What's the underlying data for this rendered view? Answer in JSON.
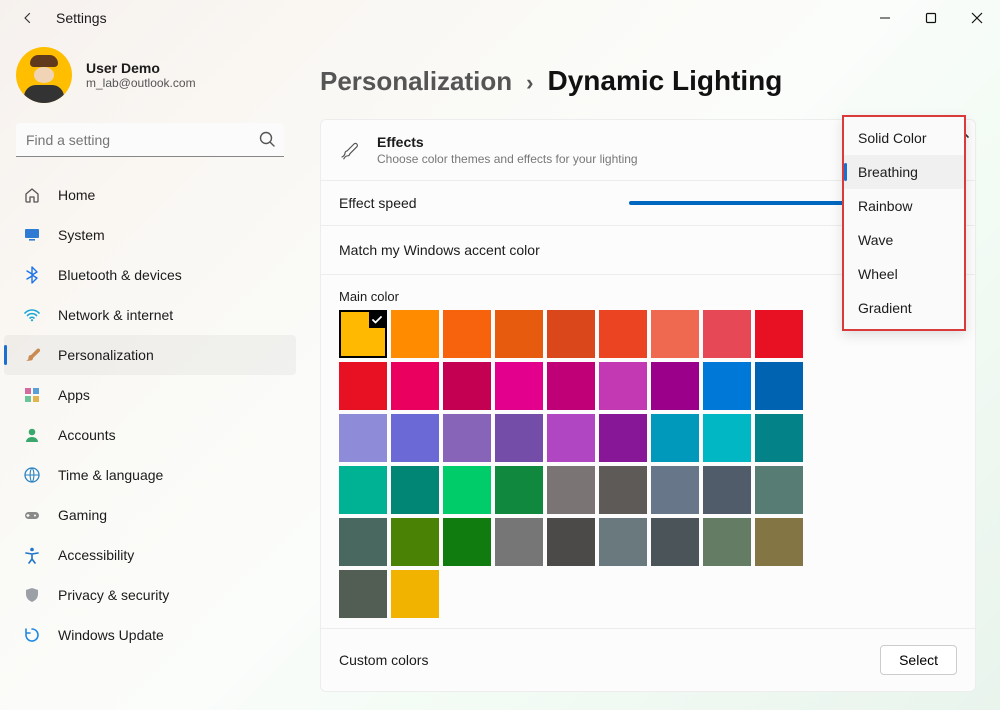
{
  "window": {
    "title": "Settings"
  },
  "profile": {
    "name": "User Demo",
    "email": "m_lab@outlook.com"
  },
  "search": {
    "placeholder": "Find a setting"
  },
  "nav": {
    "items": [
      {
        "label": "Home",
        "icon": "home"
      },
      {
        "label": "System",
        "icon": "monitor"
      },
      {
        "label": "Bluetooth & devices",
        "icon": "bluetooth"
      },
      {
        "label": "Network & internet",
        "icon": "wifi"
      },
      {
        "label": "Personalization",
        "icon": "brush",
        "selected": true
      },
      {
        "label": "Apps",
        "icon": "grid"
      },
      {
        "label": "Accounts",
        "icon": "person"
      },
      {
        "label": "Time & language",
        "icon": "globe"
      },
      {
        "label": "Gaming",
        "icon": "gamepad"
      },
      {
        "label": "Accessibility",
        "icon": "accessibility"
      },
      {
        "label": "Privacy & security",
        "icon": "shield"
      },
      {
        "label": "Windows Update",
        "icon": "update"
      }
    ]
  },
  "breadcrumb": {
    "parent": "Personalization",
    "current": "Dynamic Lighting"
  },
  "effects": {
    "title": "Effects",
    "subtitle": "Choose color themes and effects for your lighting"
  },
  "speed_label": "Effect speed",
  "accent_label": "Match my Windows accent color",
  "maincolor_label": "Main color",
  "custom_label": "Custom colors",
  "select_button": "Select",
  "dropdown": {
    "items": [
      {
        "label": "Solid Color"
      },
      {
        "label": "Breathing",
        "active": true
      },
      {
        "label": "Rainbow"
      },
      {
        "label": "Wave"
      },
      {
        "label": "Wheel"
      },
      {
        "label": "Gradient"
      }
    ]
  },
  "colors": {
    "selected_index": 0,
    "palette": [
      "#ffb900",
      "#ff8c00",
      "#f7630c",
      "#e75b0e",
      "#d9471b",
      "#ea4423",
      "#ef6950",
      "#e74856",
      "#e81123",
      "#e81123",
      "#ea005e",
      "#c30052",
      "#e3008c",
      "#bf0077",
      "#c239b3",
      "#9a0089",
      "#0078d7",
      "#0063b1",
      "#8e8cd8",
      "#6b69d6",
      "#8764b8",
      "#744da9",
      "#b146c2",
      "#881798",
      "#0099bc",
      "#00b7c3",
      "#038387",
      "#00b294",
      "#018574",
      "#00cc6a",
      "#10893e",
      "#7a7574",
      "#5d5a58",
      "#68768a",
      "#515c6b",
      "#567c73",
      "#486860",
      "#498205",
      "#107c10",
      "#767676",
      "#4c4a48",
      "#69797e",
      "#4a5459",
      "#647c64",
      "#847545",
      "#525e54",
      "#f2b200"
    ]
  }
}
